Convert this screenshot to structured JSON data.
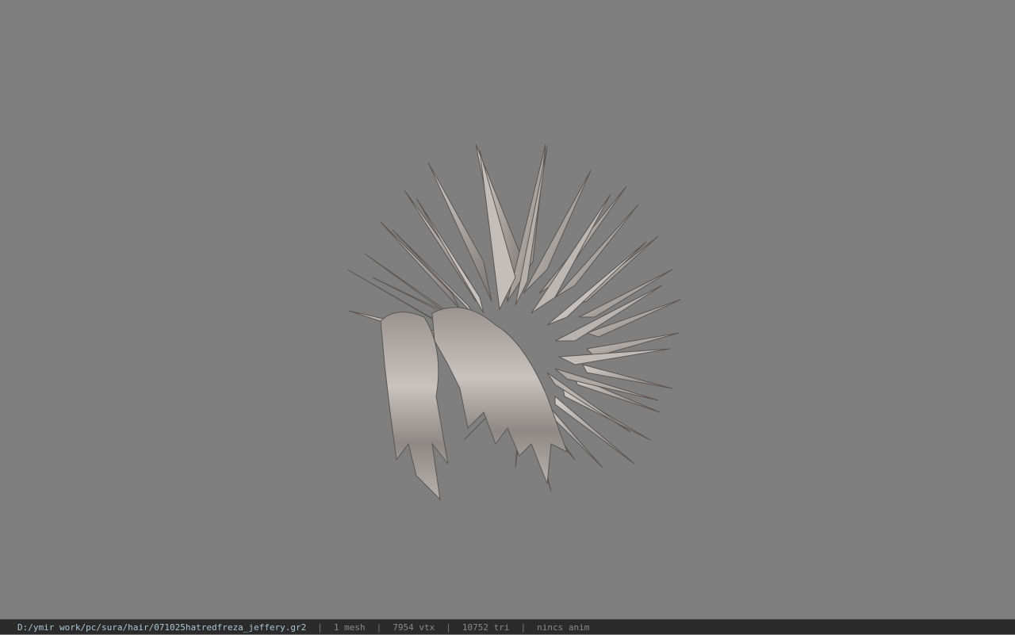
{
  "viewer": {
    "background_color": "#7f7f7f",
    "model_icon": "hair-mesh-model",
    "model_colors": {
      "base": "#a8a29f",
      "light": "#cfcac6",
      "dark": "#6f6a68"
    }
  },
  "statusbar": {
    "file_path": "D:/ymir work/pc/sura/hair/071025hatredfreza_jeffery.gr2",
    "separator": "|",
    "mesh_count": "1 mesh",
    "vertex_count": "7954 vtx",
    "triangle_count": "10752 tri",
    "anim_status": "nincs anim"
  }
}
